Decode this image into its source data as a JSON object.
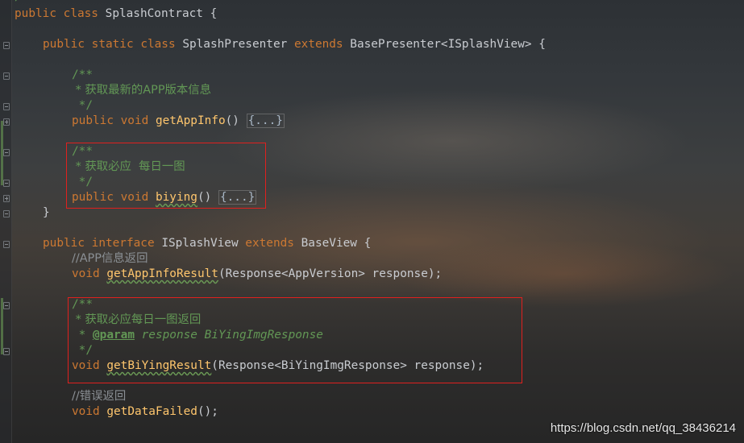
{
  "editor": {
    "lines": {
      "l0": "/",
      "l1": "public class SplashContract {",
      "l2": "public static class SplashPresenter extends BasePresenter<ISplashView> {",
      "l3": "/**",
      "l4": " * 获取最新的APP版本信息",
      "l5": " */",
      "l6_pre": "public void ",
      "l6_fn": "getAppInfo",
      "l6_args": "() ",
      "l6_fold": "{...}",
      "l7": "/**",
      "l8": " * 获取必应  每日一图",
      "l9": " */",
      "l10_pre": "public void ",
      "l10_fn": "biying",
      "l10_args": "() ",
      "l10_fold": "{...}",
      "l11": "}",
      "l12": "public interface ISplashView extends BaseView {",
      "l13": "//APP信息返回",
      "l14_pre": "void ",
      "l14_fn": "getAppInfoResult",
      "l14_args": "(Response<AppVersion> response);",
      "l15": "/**",
      "l16": " * 获取必应每日一图返回",
      "l17_star": " * ",
      "l17_tag": "@param",
      "l17_rest": " response BiYingImgResponse",
      "l18": " */",
      "l19_pre": "void ",
      "l19_fn": "getBiYingResult",
      "l19_args": "(Response<BiYingImgResponse> response);",
      "l20": "//错误返回",
      "l21_pre": "void ",
      "l21_fn": "getDataFailed",
      "l21_args": "();"
    }
  },
  "watermark": "https://blog.csdn.net/qq_38436214",
  "colors": {
    "keyword": "#cc7832",
    "function": "#ffc66d",
    "comment": "#629755",
    "highlight_box": "#e0201e"
  }
}
